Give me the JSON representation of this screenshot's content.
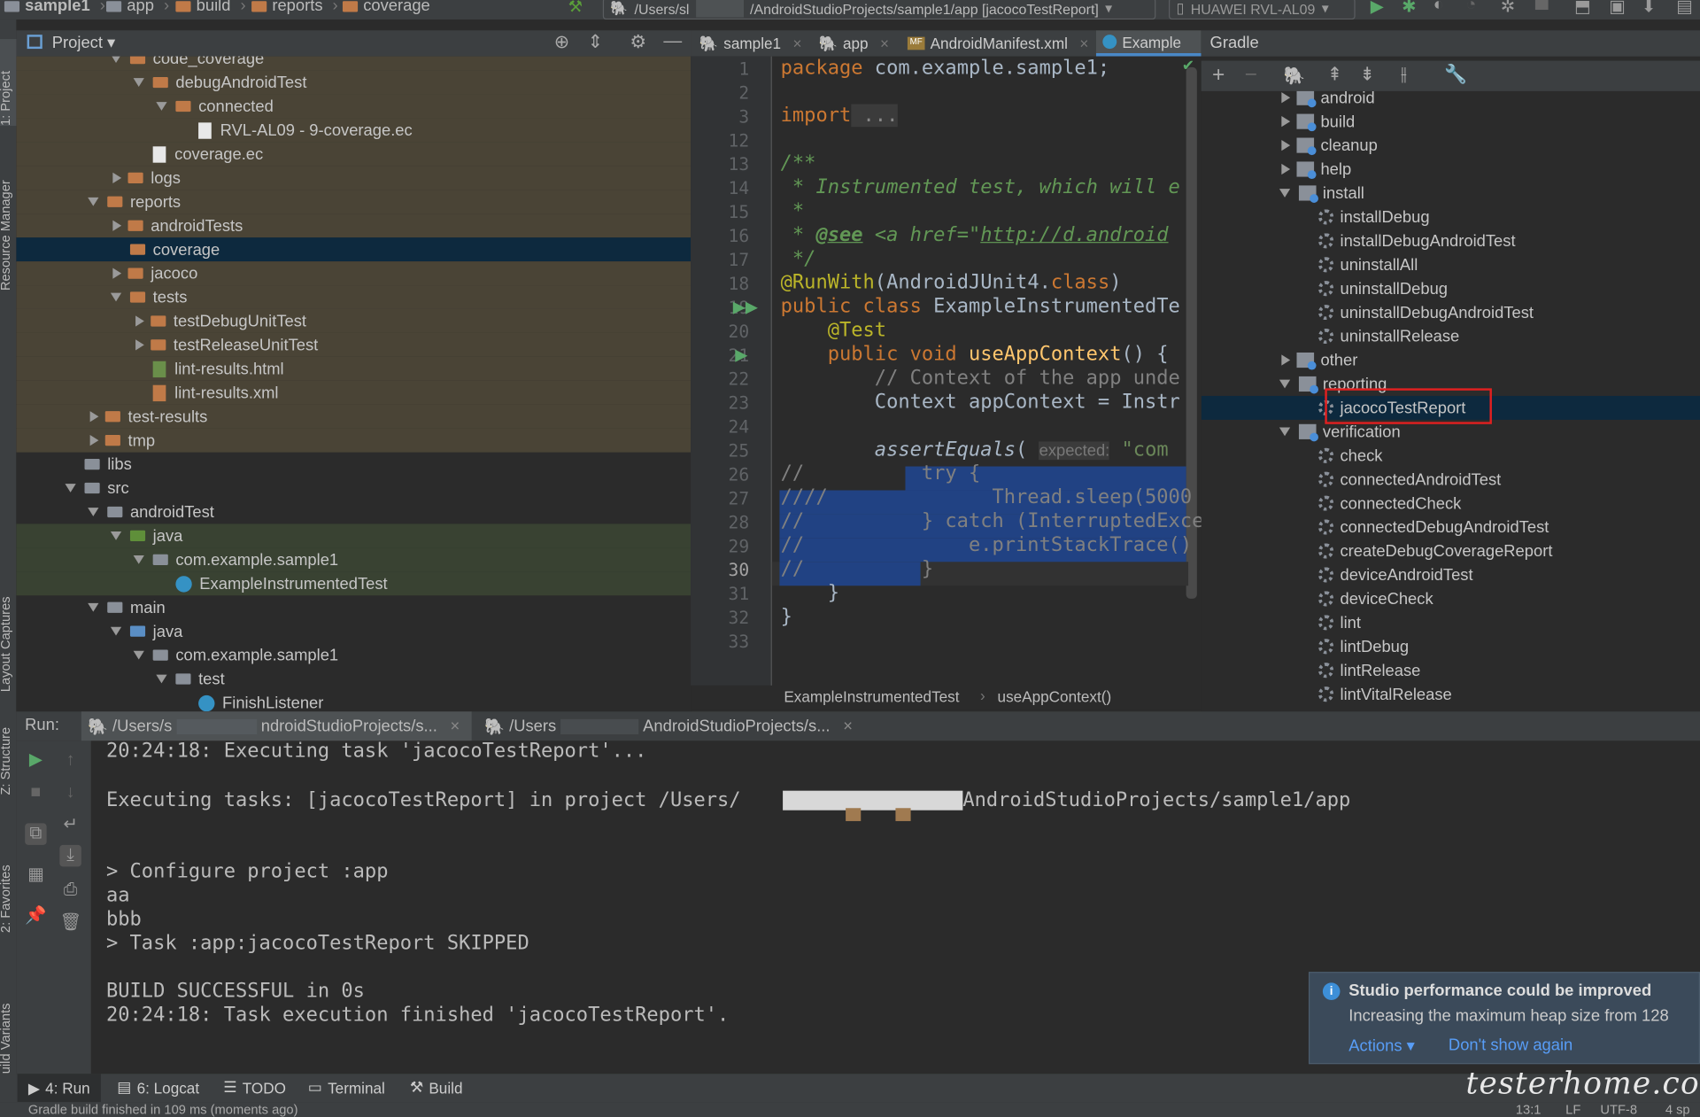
{
  "titlebar": {
    "crumbs": [
      "sample1",
      "app",
      "build",
      "reports",
      "coverage"
    ],
    "path": "/Users/sl",
    "path2": "/AndroidStudioProjects/sample1/app [jacocoTestReport]",
    "device": "HUAWEI RVL-AL09"
  },
  "side_left": {
    "project": "1: Project",
    "resource": "Resource Manager",
    "layout": "Layout Captures",
    "structure": "Z: Structure",
    "favorites": "2: Favorites",
    "variants": "Build Variants"
  },
  "project_panel": {
    "title": "Project"
  },
  "tree": [
    {
      "label": "code_coverage",
      "indent": 5,
      "arrow": "down",
      "icon": "folder"
    },
    {
      "label": "debugAndroidTest",
      "indent": 6,
      "arrow": "down",
      "icon": "folder"
    },
    {
      "label": "connected",
      "indent": 7,
      "arrow": "down",
      "icon": "folder"
    },
    {
      "label": "RVL-AL09 - 9-coverage.ec",
      "indent": 8,
      "arrow": "",
      "icon": "file"
    },
    {
      "label": "coverage.ec",
      "indent": 6,
      "arrow": "",
      "icon": "file"
    },
    {
      "label": "logs",
      "indent": 5,
      "arrow": "right",
      "icon": "folder"
    },
    {
      "label": "reports",
      "indent": 4,
      "arrow": "down",
      "icon": "folder"
    },
    {
      "label": "androidTests",
      "indent": 5,
      "arrow": "right",
      "icon": "folder"
    },
    {
      "label": "coverage",
      "indent": 5,
      "arrow": "",
      "icon": "folder",
      "selected": true
    },
    {
      "label": "jacoco",
      "indent": 5,
      "arrow": "right",
      "icon": "folder"
    },
    {
      "label": "tests",
      "indent": 5,
      "arrow": "down",
      "icon": "folder"
    },
    {
      "label": "testDebugUnitTest",
      "indent": 6,
      "arrow": "right",
      "icon": "folder"
    },
    {
      "label": "testReleaseUnitTest",
      "indent": 6,
      "arrow": "right",
      "icon": "folder"
    },
    {
      "label": "lint-results.html",
      "indent": 6,
      "arrow": "",
      "icon": "html"
    },
    {
      "label": "lint-results.xml",
      "indent": 6,
      "arrow": "",
      "icon": "xml"
    },
    {
      "label": "test-results",
      "indent": 4,
      "arrow": "right",
      "icon": "folder"
    },
    {
      "label": "tmp",
      "indent": 4,
      "arrow": "right",
      "icon": "folder"
    },
    {
      "label": "libs",
      "indent": 3,
      "arrow": "",
      "icon": "gray"
    },
    {
      "label": "src",
      "indent": 3,
      "arrow": "down",
      "icon": "gray"
    },
    {
      "label": "androidTest",
      "indent": 4,
      "arrow": "down",
      "icon": "gray"
    },
    {
      "label": "java",
      "indent": 5,
      "arrow": "down",
      "icon": "green",
      "green": true
    },
    {
      "label": "com.example.sample1",
      "indent": 6,
      "arrow": "down",
      "icon": "pkg",
      "green": true
    },
    {
      "label": "ExampleInstrumentedTest",
      "indent": 7,
      "arrow": "",
      "icon": "class",
      "green": true
    },
    {
      "label": "main",
      "indent": 4,
      "arrow": "down",
      "icon": "gray"
    },
    {
      "label": "java",
      "indent": 5,
      "arrow": "down",
      "icon": "blue"
    },
    {
      "label": "com.example.sample1",
      "indent": 6,
      "arrow": "down",
      "icon": "pkg"
    },
    {
      "label": "test",
      "indent": 7,
      "arrow": "down",
      "icon": "pkg"
    },
    {
      "label": "FinishListener",
      "indent": 8,
      "arrow": "",
      "icon": "class"
    }
  ],
  "tabs": [
    "sample1",
    "app",
    "AndroidManifest.xml",
    "Example"
  ],
  "editor": {
    "line_numbers": [
      "1",
      "2",
      "3",
      "12",
      "13",
      "14",
      "15",
      "16",
      "17",
      "18",
      "19",
      "20",
      "21",
      "22",
      "23",
      "24",
      "25",
      "26",
      "27",
      "28",
      "29",
      "30",
      "31",
      "32",
      "33"
    ],
    "l1a": "package",
    "l1b": " com.example.sample1;",
    "l3a": "import",
    "l3b": " ...",
    "l13": "/**",
    "l14": " * Instrumented test, which will e",
    "l15": " *",
    "l16a": " * ",
    "l16b": "@see",
    "l16c": " <a href=\"",
    "l16d": "http://d.android",
    "l17": " */",
    "l18a": "@RunWith",
    "l18b": "(AndroidJUnit4.",
    "l18c": "class",
    ")": ")",
    "l19a": "public class",
    "l19b": " ExampleInstrumentedTe",
    "l20": "    @Test",
    "l21a": "    public void ",
    "l21b": "useAppContext",
    "l21c": "() {",
    "l22": "        // Context of the app unde",
    "l23": "        Context appContext = Instr",
    "l25a": "        assertEquals",
    "l25b": "( ",
    "l25c": "expected:",
    "l25d": " \"com",
    "l26": "//          try {",
    "l27": "////              Thread.sleep(5000",
    "l28": "//          } catch (InterruptedExce",
    "l29": "//              e.printStackTrace()",
    "l30": "//          }",
    "l31": "    }",
    "l32": "}"
  },
  "editor_crumbs": [
    "ExampleInstrumentedTest",
    "useAppContext()"
  ],
  "gradle": {
    "title": "Gradle",
    "items": [
      {
        "label": "android",
        "type": "folder",
        "indent": 0,
        "arrow": "right"
      },
      {
        "label": "build",
        "type": "folder",
        "indent": 0,
        "arrow": "right"
      },
      {
        "label": "cleanup",
        "type": "folder",
        "indent": 0,
        "arrow": "right"
      },
      {
        "label": "help",
        "type": "folder",
        "indent": 0,
        "arrow": "right"
      },
      {
        "label": "install",
        "type": "folder",
        "indent": 0,
        "arrow": "down"
      },
      {
        "label": "installDebug",
        "type": "task",
        "indent": 1
      },
      {
        "label": "installDebugAndroidTest",
        "type": "task",
        "indent": 1
      },
      {
        "label": "uninstallAll",
        "type": "task",
        "indent": 1
      },
      {
        "label": "uninstallDebug",
        "type": "task",
        "indent": 1
      },
      {
        "label": "uninstallDebugAndroidTest",
        "type": "task",
        "indent": 1
      },
      {
        "label": "uninstallRelease",
        "type": "task",
        "indent": 1
      },
      {
        "label": "other",
        "type": "folder",
        "indent": 0,
        "arrow": "right"
      },
      {
        "label": "reporting",
        "type": "folder",
        "indent": 0,
        "arrow": "down"
      },
      {
        "label": "jacocoTestReport",
        "type": "task",
        "indent": 1,
        "selected": true
      },
      {
        "label": "verification",
        "type": "folder",
        "indent": 0,
        "arrow": "down"
      },
      {
        "label": "check",
        "type": "task",
        "indent": 1
      },
      {
        "label": "connectedAndroidTest",
        "type": "task",
        "indent": 1
      },
      {
        "label": "connectedCheck",
        "type": "task",
        "indent": 1
      },
      {
        "label": "connectedDebugAndroidTest",
        "type": "task",
        "indent": 1
      },
      {
        "label": "createDebugCoverageReport",
        "type": "task",
        "indent": 1
      },
      {
        "label": "deviceAndroidTest",
        "type": "task",
        "indent": 1
      },
      {
        "label": "deviceCheck",
        "type": "task",
        "indent": 1
      },
      {
        "label": "lint",
        "type": "task",
        "indent": 1
      },
      {
        "label": "lintDebug",
        "type": "task",
        "indent": 1
      },
      {
        "label": "lintRelease",
        "type": "task",
        "indent": 1
      },
      {
        "label": "lintVitalRelease",
        "type": "task",
        "indent": 1
      }
    ]
  },
  "run": {
    "label": "Run:",
    "tab1a": "/Users/s",
    "tab1b": "ndroidStudioProjects/s...",
    "tab2a": "/Users",
    "tab2b": "AndroidStudioProjects/s..."
  },
  "console": [
    "20:24:18: Executing task 'jacocoTestReport'...",
    "",
    "Executing tasks: [jacocoTestReport] in project /Users/",
    "",
    "",
    "> Configure project :app",
    "aa",
    "bbb",
    "> Task :app:jacocoTestReport SKIPPED",
    "",
    "BUILD SUCCESSFUL in 0s",
    "20:24:18: Task execution finished 'jacocoTestReport'."
  ],
  "console_tail": "AndroidStudioProjects/sample1/app",
  "bottom": {
    "run": "4: Run",
    "logcat": "6: Logcat",
    "todo": "TODO",
    "terminal": "Terminal",
    "build": "Build"
  },
  "status": {
    "message": "Gradle build finished in 109 ms (moments ago)",
    "pos": "13:1",
    "lf": "LF",
    "enc": "UTF-8",
    "indent": "4 sp"
  },
  "notification": {
    "title": "Studio performance could be improved",
    "body": "Increasing the maximum heap size from 128",
    "actions": "Actions",
    "dismiss": "Don't show again"
  },
  "watermark": "testerhome.com"
}
